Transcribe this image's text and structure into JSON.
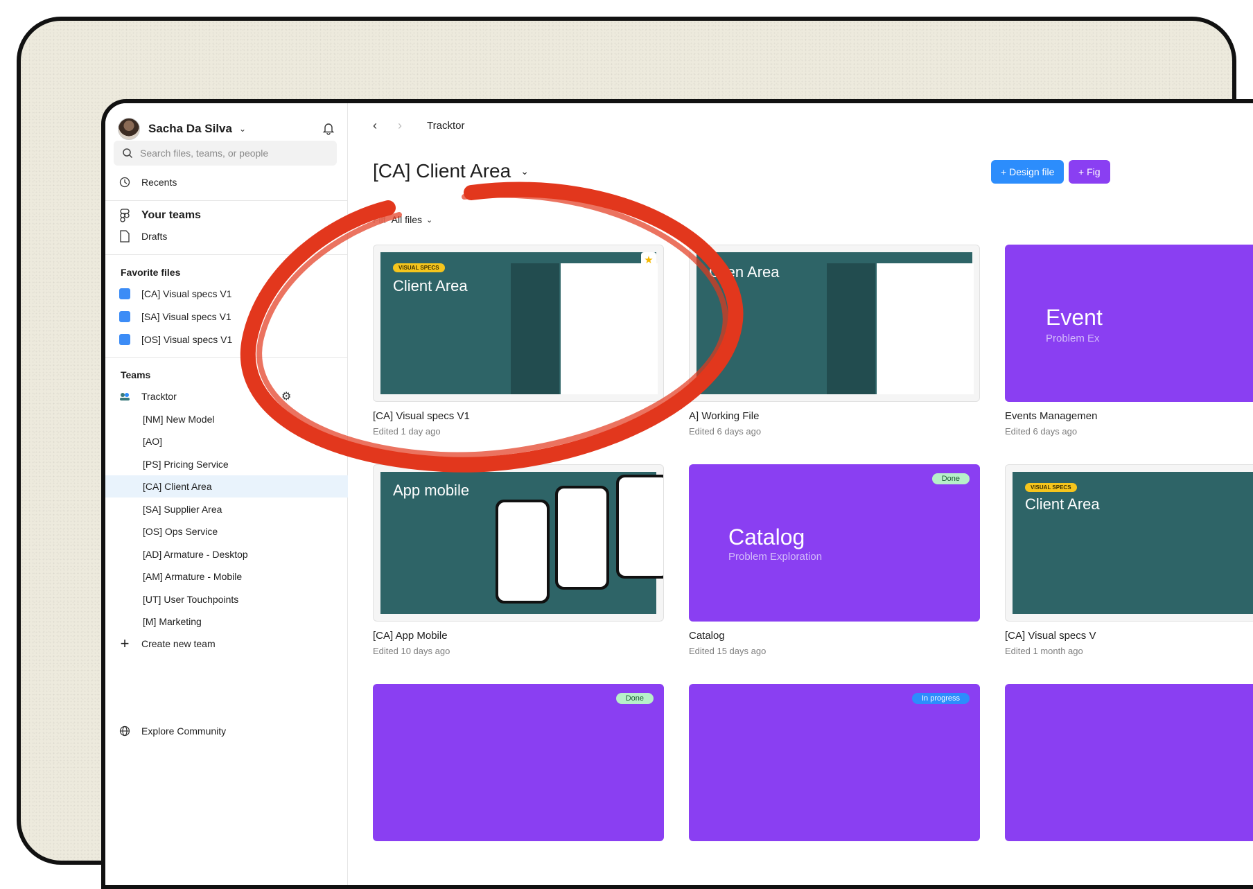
{
  "user": {
    "name": "Sacha Da Silva"
  },
  "search": {
    "placeholder": "Search files, teams, or people"
  },
  "nav": {
    "recents": "Recents",
    "your_teams": "Your teams",
    "drafts": "Drafts"
  },
  "favorites": {
    "title": "Favorite files",
    "items": [
      "[CA] Visual specs V1",
      "[SA] Visual specs V1",
      "[OS] Visual specs V1"
    ]
  },
  "teams": {
    "title": "Teams",
    "team": "Tracktor",
    "projects": [
      "[NM] New Model",
      "[AO]",
      "[PS] Pricing Service",
      "[CA] Client Area",
      "[SA] Supplier Area",
      "[OS] Ops Service",
      "[AD] Armature - Desktop",
      "[AM] Armature - Mobile",
      "[UT] User Touchpoints",
      "[M] Marketing"
    ],
    "create": "Create new team"
  },
  "explore": "Explore Community",
  "breadcrumb": {
    "current": "Tracktor"
  },
  "page": {
    "title": "[CA] Client Area"
  },
  "buttons": {
    "design_file": "Design file",
    "figjam": "Fig"
  },
  "filter": {
    "label": "Filt",
    "value": "All files"
  },
  "cards": [
    {
      "name": "[CA] Visual specs V1",
      "meta": "Edited 1 day ago",
      "tag": "VISUAL SPECS",
      "thumb_title": "Client Area"
    },
    {
      "name": "A] Working File",
      "meta": "Edited 6 days ago",
      "thumb_title": "Clien Area"
    },
    {
      "name": "Events Managemen",
      "meta": "Edited 6 days ago",
      "thumb_title": "Event",
      "thumb_sub": "Problem Ex"
    },
    {
      "name": "[CA] App Mobile",
      "meta": "Edited 10 days ago",
      "thumb_title": "App mobile"
    },
    {
      "name": "Catalog",
      "meta": "Edited 15 days ago",
      "thumb_title": "Catalog",
      "thumb_sub": "Problem Exploration",
      "badge": "Done"
    },
    {
      "name": "[CA] Visual specs V",
      "meta": "Edited 1 month ago",
      "tag": "VISUAL SPECS",
      "thumb_title": "Client Area"
    },
    {
      "badge": "Done"
    },
    {
      "badge": "In progress"
    },
    {}
  ],
  "colors": {
    "accent_blue": "#2c8dfc",
    "accent_purple": "#8a3ff2",
    "teal": "#2e6467",
    "annotation_red": "#e2371d"
  }
}
